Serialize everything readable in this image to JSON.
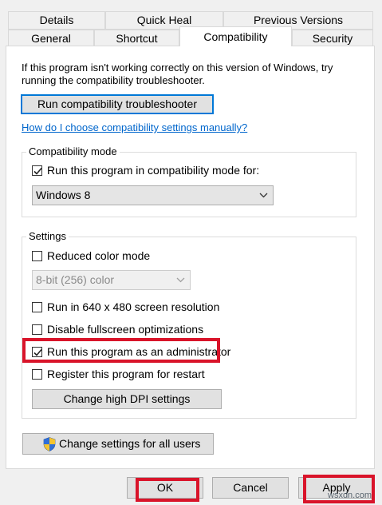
{
  "tabs": {
    "row_top": [
      "Details",
      "Quick Heal",
      "Previous Versions"
    ],
    "row_bottom": [
      "General",
      "Shortcut",
      "Compatibility",
      "Security"
    ],
    "active": "Compatibility"
  },
  "intro": {
    "text_line1": "If this program isn't working correctly on this version of Windows, try",
    "text_line2": "running the compatibility troubleshooter.",
    "troubleshooter_button": "Run compatibility troubleshooter",
    "help_link": "How do I choose compatibility settings manually?"
  },
  "compatibility_mode": {
    "legend": "Compatibility mode",
    "checkbox_label": "Run this program in compatibility mode for:",
    "checked": true,
    "selected_os": "Windows 8"
  },
  "settings": {
    "legend": "Settings",
    "reduced_color_label": "Reduced color mode",
    "reduced_color_checked": false,
    "color_option": "8-bit (256) color",
    "resolution_label": "Run in 640 x 480 screen resolution",
    "resolution_checked": false,
    "fullscreen_label": "Disable fullscreen optimizations",
    "fullscreen_checked": false,
    "admin_label": "Run this program as an administrator",
    "admin_checked": true,
    "restart_label": "Register this program for restart",
    "restart_checked": false,
    "dpi_button": "Change high DPI settings"
  },
  "all_users_button": "Change settings for all users",
  "footer": {
    "ok": "OK",
    "cancel": "Cancel",
    "apply": "Apply"
  },
  "watermark": "wsxdn.com",
  "colors": {
    "highlight": "#d9142a",
    "link": "#0066cc",
    "focus_border": "#0078d7"
  },
  "icons": {
    "shield": "uac-shield-icon",
    "check": "check-icon",
    "dropdown": "chevron-down-icon"
  }
}
